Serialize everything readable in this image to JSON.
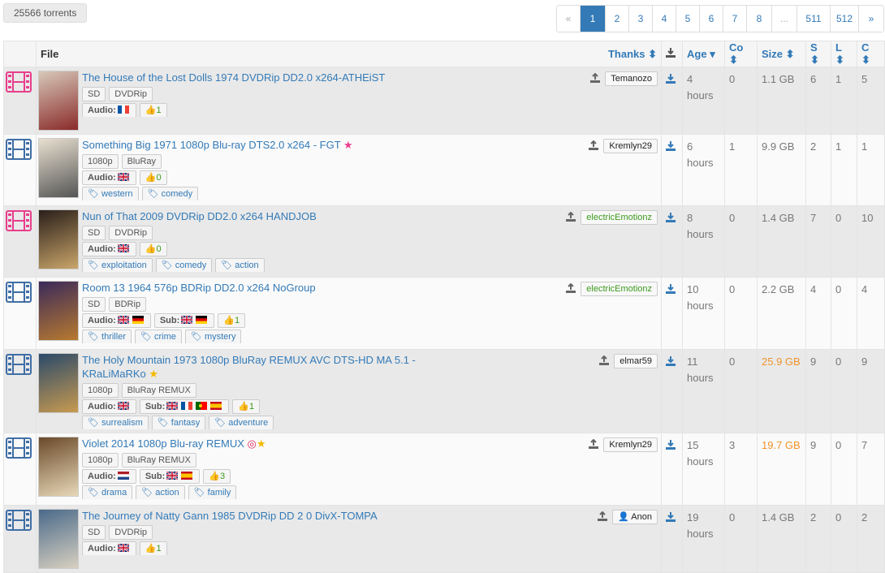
{
  "torrent_count": "25566 torrents",
  "pagination": [
    "«",
    "1",
    "2",
    "3",
    "4",
    "5",
    "6",
    "7",
    "8",
    "...",
    "511",
    "512",
    "»"
  ],
  "table": {
    "headers": {
      "file": "File",
      "thanks": "Thanks",
      "age": "Age",
      "co": "Co",
      "size": "Size",
      "s": "S",
      "l": "L",
      "c": "C"
    },
    "rows": [
      {
        "cat": "pink",
        "title": "The House of the Lost Dolls 1974 DVDRip DD2.0 x264-ATHEiST",
        "badges": [
          "SD",
          "DVDRip"
        ],
        "audio": [
          "fr"
        ],
        "sub": [],
        "thanks": "1",
        "genres": [],
        "uploader": "Temanozo",
        "age": "4 hours",
        "co": "0",
        "size": "1.1 GB",
        "s": "6",
        "l": "1",
        "c": "5",
        "star": "",
        "bg": "grey"
      },
      {
        "cat": "blue",
        "title": "Something Big 1971 1080p Blu-ray DTS2.0 x264 - FGT",
        "badges": [
          "1080p",
          "BluRay"
        ],
        "audio": [
          "gb"
        ],
        "sub": [],
        "thanks": "0",
        "genres": [
          "western",
          "comedy"
        ],
        "uploader": "Kremlyn29",
        "age": "6 hours",
        "co": "1",
        "size": "9.9 GB",
        "s": "2",
        "l": "1",
        "c": "1",
        "star": "pink",
        "bg": "white"
      },
      {
        "cat": "pink",
        "title": "Nun of That 2009 DVDRip DD2.0 x264 HANDJOB",
        "badges": [
          "SD",
          "DVDRip"
        ],
        "audio": [
          "gb"
        ],
        "sub": [],
        "thanks": "0",
        "genres": [
          "exploitation",
          "comedy",
          "action"
        ],
        "uploader": "electricEmotionz",
        "age": "8 hours",
        "co": "0",
        "size": "1.4 GB",
        "s": "7",
        "l": "0",
        "c": "10",
        "star": "",
        "bg": "grey"
      },
      {
        "cat": "blue",
        "title": "Room 13 1964 576p BDRip DD2.0 x264 NoGroup",
        "badges": [
          "SD",
          "BDRip"
        ],
        "audio": [
          "gb",
          "de"
        ],
        "sub": [
          "gb",
          "de"
        ],
        "thanks": "1",
        "genres": [
          "thriller",
          "crime",
          "mystery"
        ],
        "uploader": "electricEmotionz",
        "age": "10 hours",
        "co": "0",
        "size": "2.2 GB",
        "s": "4",
        "l": "0",
        "c": "4",
        "star": "",
        "bg": "white"
      },
      {
        "cat": "blue",
        "title": "The Holy Mountain 1973 1080p BluRay REMUX AVC DTS-HD MA 5.1 - KRaLiMaRKo",
        "badges": [
          "1080p",
          "BluRay REMUX"
        ],
        "audio": [
          "gb"
        ],
        "sub": [
          "gb",
          "fr",
          "pt",
          "es"
        ],
        "thanks": "1",
        "genres": [
          "surrealism",
          "fantasy",
          "adventure"
        ],
        "uploader": "elmar59",
        "age": "11 hours",
        "co": "0",
        "size": "25.9 GB",
        "s": "9",
        "l": "0",
        "c": "9",
        "star": "gold",
        "bg": "grey"
      },
      {
        "cat": "blue",
        "title": "Violet 2014 1080p Blu-ray REMUX",
        "badges": [
          "1080p",
          "BluRay REMUX"
        ],
        "audio": [
          "nl"
        ],
        "sub": [
          "gb",
          "es"
        ],
        "thanks": "3",
        "genres": [
          "drama",
          "action",
          "family"
        ],
        "uploader": "Kremlyn29",
        "age": "15 hours",
        "co": "3",
        "size": "19.7 GB",
        "s": "9",
        "l": "0",
        "c": "7",
        "star": "target-gold",
        "bg": "white"
      },
      {
        "cat": "blue",
        "title": "The Journey of Natty Gann 1985 DVDRip DD 2 0 DivX-TOMPA",
        "badges": [
          "SD",
          "DVDRip"
        ],
        "audio": [
          "gb"
        ],
        "sub": [],
        "thanks": "1",
        "genres": [],
        "uploader": "Anon",
        "age": "19 hours",
        "co": "0",
        "size": "1.4 GB",
        "s": "2",
        "l": "0",
        "c": "2",
        "star": "",
        "bg": "grey"
      }
    ],
    "audio_label": "Audio:",
    "sub_label": "Sub:"
  },
  "colors": {
    "link": "#337ab7",
    "pink_cat": "#e83e8c",
    "blue_cat": "#3f6ea6",
    "orange": "#f0932b",
    "green": "#3c9a1e"
  }
}
